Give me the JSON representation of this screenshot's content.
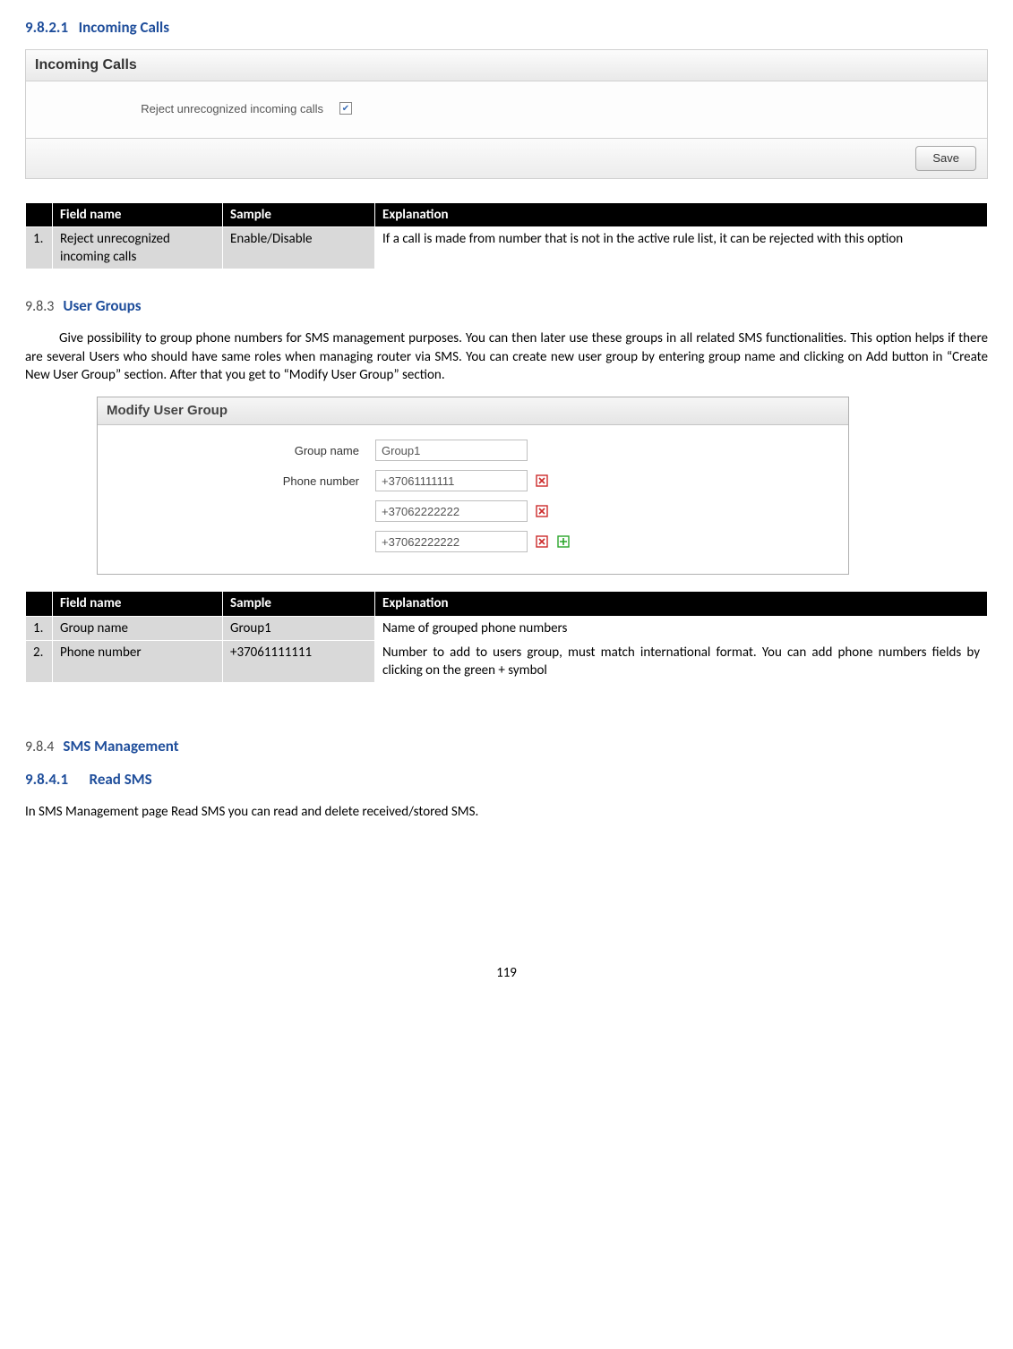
{
  "section_9821": {
    "number": "9.8.2.1",
    "title": "Incoming Calls"
  },
  "incoming_panel": {
    "header": "Incoming Calls",
    "checkbox_label": "Reject unrecognized incoming calls",
    "save_button": "Save"
  },
  "table1": {
    "headers": {
      "num": "",
      "field": "Field name",
      "sample": "Sample",
      "expl": "Explanation"
    },
    "rows": [
      {
        "num": "1.",
        "field": "Reject unrecognized incoming calls",
        "sample": "Enable/Disable",
        "expl": "If a call is made from number that is not in the active rule list, it can be rejected with this option"
      }
    ]
  },
  "section_983": {
    "number": "9.8.3",
    "title": "User Groups",
    "para": "Give possibility to group phone numbers for SMS management purposes. You can then later use these groups in all related SMS functionalities. This option helps if there are several Users who should have same roles when managing router via SMS. You can create new user group by entering group name and clicking on Add button in “Create New User Group” section. After that you get to “Modify User Group” section."
  },
  "modify_panel": {
    "header": "Modify User Group",
    "group_name_label": "Group name",
    "group_name_value": "Group1",
    "phone_label": "Phone number",
    "phones": [
      "+37061111111",
      "+37062222222",
      "+37062222222"
    ]
  },
  "table2": {
    "headers": {
      "num": "",
      "field": "Field name",
      "sample": "Sample",
      "expl": "Explanation"
    },
    "rows": [
      {
        "num": "1.",
        "field": "Group name",
        "sample": "Group1",
        "expl": "Name of grouped phone numbers"
      },
      {
        "num": "2.",
        "field": "Phone number",
        "sample": "+37061111111",
        "expl": "Number to add to users group, must match international format. You can add phone numbers fields by clicking on the green + symbol"
      }
    ]
  },
  "section_984": {
    "number": "9.8.4",
    "title": "SMS Management"
  },
  "section_9841": {
    "number": "9.8.4.1",
    "title": "Read SMS",
    "body": "In SMS Management page Read SMS you can read and delete received/stored SMS."
  },
  "page_number": "119"
}
